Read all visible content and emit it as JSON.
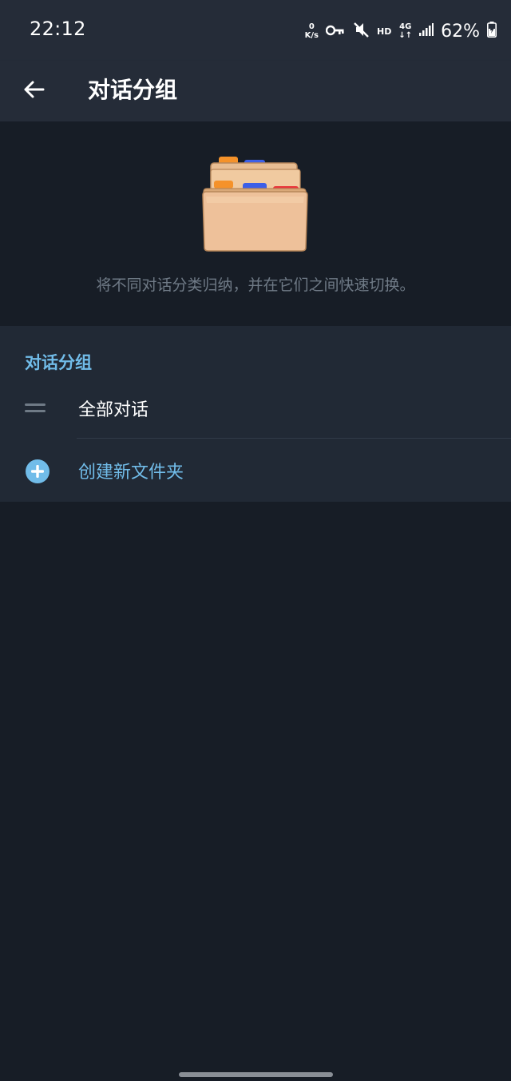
{
  "status_bar": {
    "time": "22:12",
    "net_speed_value": "0",
    "net_speed_unit": "K/s",
    "hd_label": "HD",
    "network_type": "4G",
    "battery": "62%",
    "icons": [
      "key-icon",
      "mute-icon",
      "signal-icon",
      "battery-icon"
    ]
  },
  "app_bar": {
    "title": "对话分组"
  },
  "hero": {
    "description": "将不同对话分类归纳，并在它们之间快速切换。"
  },
  "section": {
    "header": "对话分组",
    "items": [
      {
        "label": "全部对话",
        "icon": "drag-handle-icon"
      }
    ],
    "create_label": "创建新文件夹",
    "create_icon": "plus-circle-icon"
  },
  "colors": {
    "background": "#171d26",
    "app_bar": "#252c38",
    "section": "#212935",
    "accent": "#71bce9",
    "muted_text": "#6f7a86"
  }
}
